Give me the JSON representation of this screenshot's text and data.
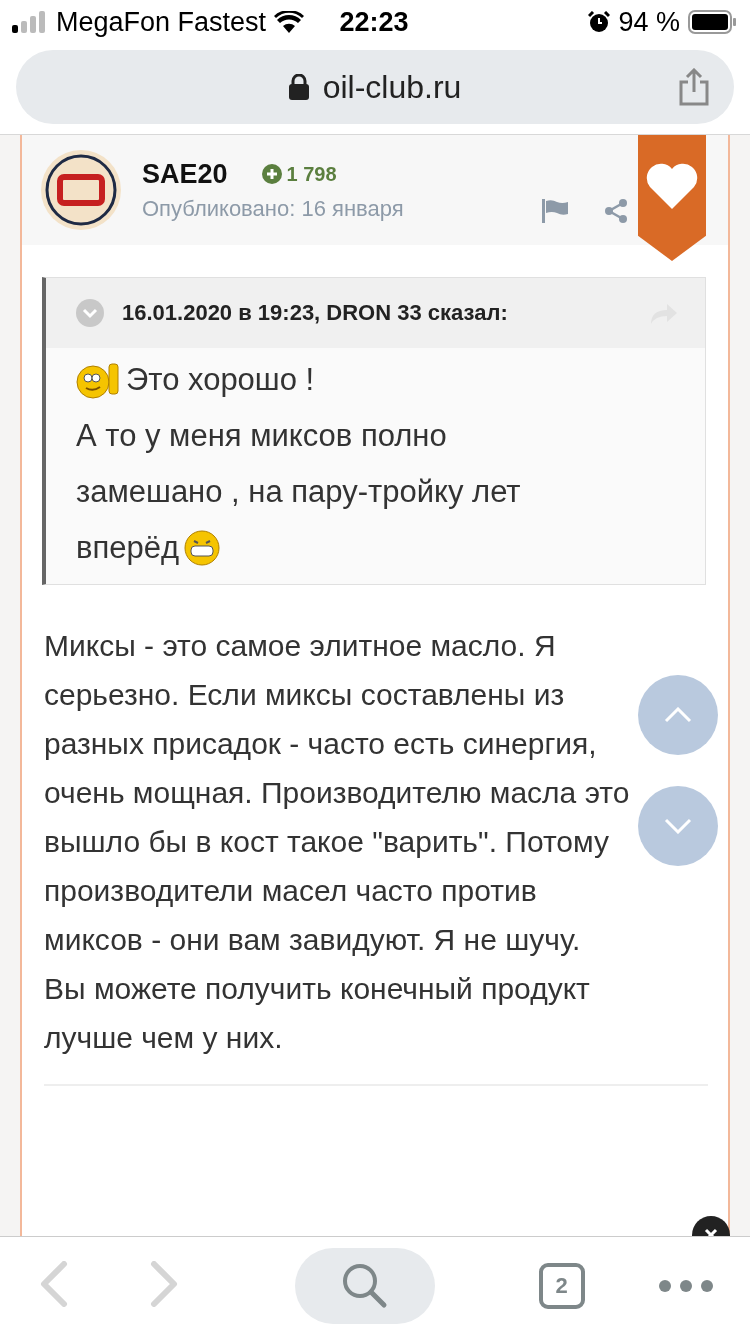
{
  "status_bar": {
    "carrier": "MegaFon Fastest",
    "time": "22:23",
    "battery": "94 %"
  },
  "address_bar": {
    "url": "oil-club.ru"
  },
  "post": {
    "author": "SAE20",
    "reputation": "1 798",
    "published": "Опубликовано: 16 января",
    "liked": true,
    "quote": {
      "header": "16.01.2020 в 19:23, DRON 33 сказал:",
      "lines": [
        {
          "text": "Это хорошо !",
          "emoji_before": true,
          "emoji_after": false
        },
        {
          "text": "А то у меня миксов полно",
          "emoji_before": false,
          "emoji_after": false
        },
        {
          "text": "замешано , на пару-тройку лет",
          "emoji_before": false,
          "emoji_after": false
        },
        {
          "text": "вперёд",
          "emoji_before": false,
          "emoji_after": true
        }
      ]
    },
    "body": "Миксы - это самое элитное масло. Я серьезно. Если миксы составлены из разных присадок - часто есть синергия, очень мощная. Производителю масла это вышло бы в кост такое \"варить\". Потому производители масел часто против миксов - они вам завидуют. Я не шучу. Вы можете получить конечный продукт лучше чем у них."
  },
  "toolbar": {
    "tab_count": "2",
    "back_disabled": true,
    "forward_disabled": true
  }
}
